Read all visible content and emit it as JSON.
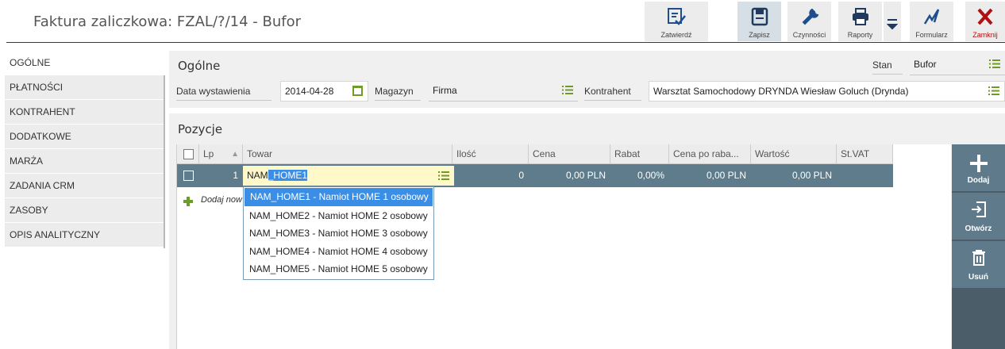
{
  "title": "Faktura zaliczkowa: FZAL/?/14 - Bufor",
  "toolbar": {
    "approve": "Zatwierdź",
    "save": "Zapisz",
    "actions": "Czynności",
    "reports": "Raporty",
    "form": "Formularz",
    "close": "Zamknij"
  },
  "nav": {
    "items": [
      "OGÓLNE",
      "PŁATNOŚCI",
      "KONTRAHENT",
      "DODATKOWE",
      "MARŻA",
      "ZADANIA CRM",
      "ZASOBY",
      "OPIS ANALITYCZNY"
    ]
  },
  "general": {
    "title": "Ogólne",
    "state_label": "Stan",
    "state_value": "Bufor",
    "date_label": "Data wystawienia",
    "date_value": "2014-04-28",
    "warehouse_label": "Magazyn",
    "warehouse_value": "Firma",
    "contractor_label": "Kontrahent",
    "contractor_value": "Warsztat Samochodowy DRYNDA Wiesław Goluch  (Drynda)"
  },
  "positions": {
    "title": "Pozycje",
    "columns": [
      "Lp",
      "Towar",
      "Ilość",
      "Cena",
      "Rabat",
      "Cena po raba...",
      "Wartość",
      "St.VAT"
    ],
    "row": {
      "lp": "1",
      "item_prefix": "NAM",
      "item_selected": "_HOME1",
      "qty": "0",
      "price": "0,00 PLN",
      "discount": "0,00%",
      "price_after": "0,00 PLN",
      "value": "0,00 PLN",
      "vat": ""
    },
    "add_new": "Dodaj now",
    "suggestions": [
      "NAM_HOME1 - Namiot HOME 1 osobowy",
      "NAM_HOME2 - Namiot HOME 2 osobowy",
      "NAM_HOME3 - Namiot HOME 3 osobowy",
      "NAM_HOME4 - Namiot HOME 4 osobowy",
      "NAM_HOME5 - Namiot HOME 5 osobowy"
    ]
  },
  "actions": {
    "add": "Dodaj",
    "open": "Otwórz",
    "delete": "Usuń"
  },
  "colors": {
    "row_selected": "#5f7c8c",
    "highlight": "#3a8ee6",
    "accent_green": "#6f9b2a",
    "close_red": "#b01010",
    "icon_blue": "#1f4e8c"
  }
}
